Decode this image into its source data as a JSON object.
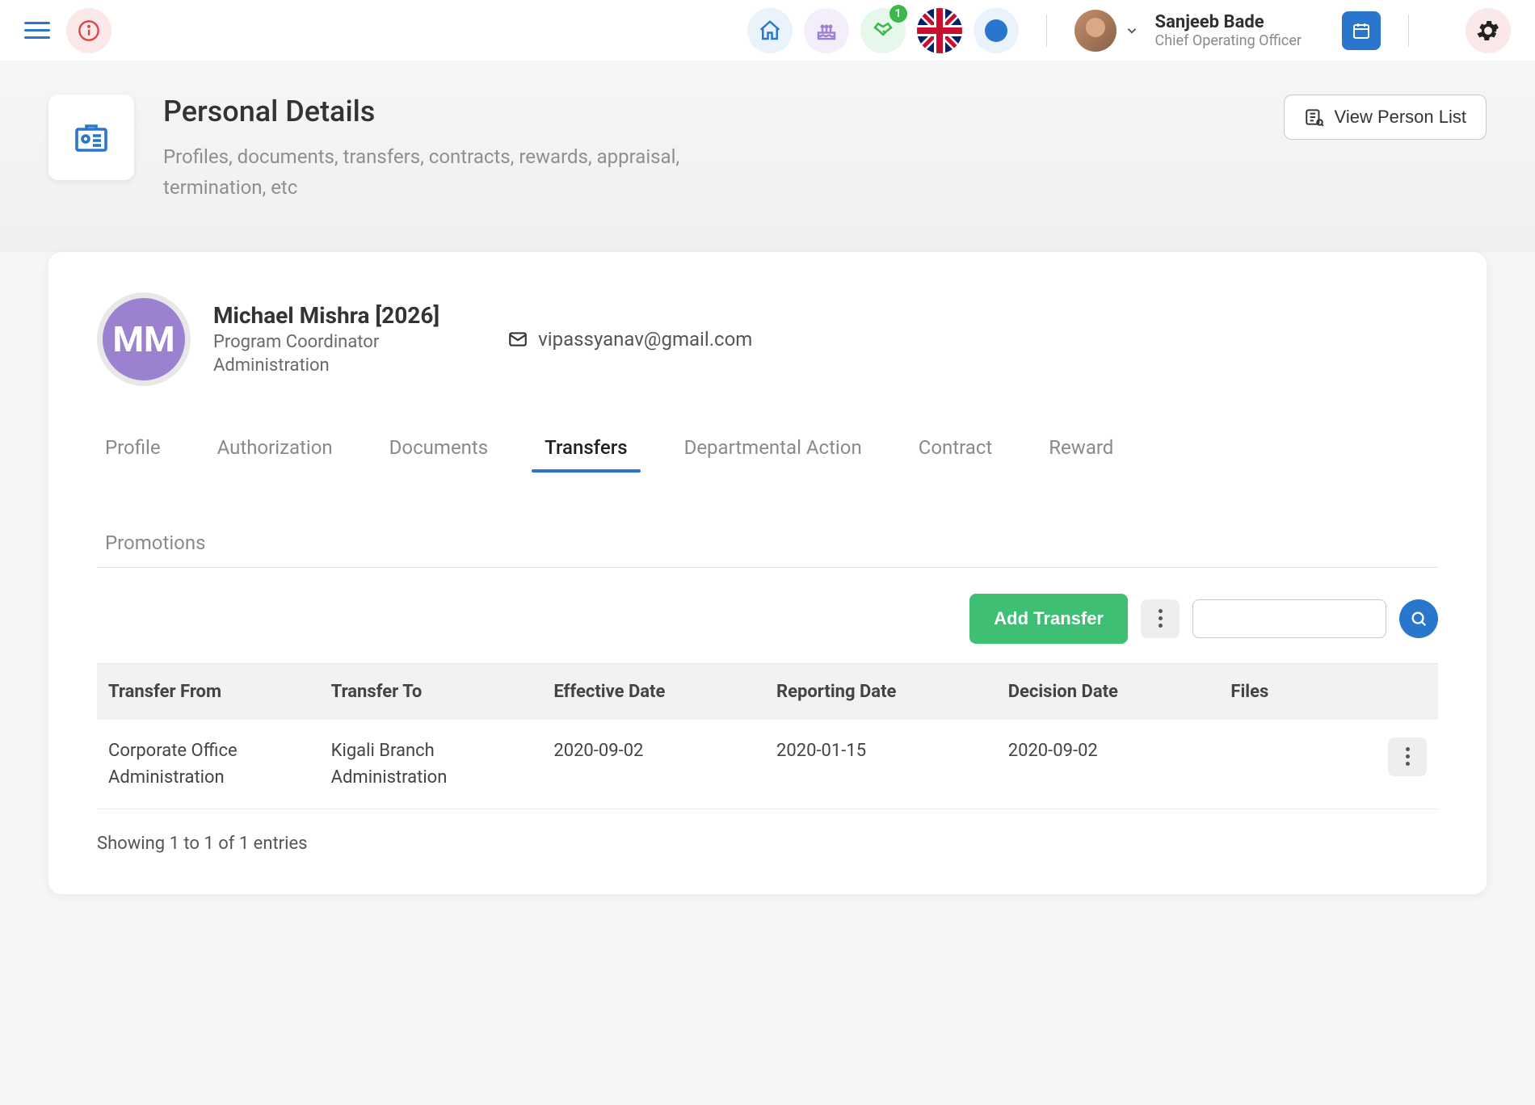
{
  "topbar": {
    "handshake_badge": "1",
    "user_name": "Sanjeeb Bade",
    "user_role": "Chief Operating Officer"
  },
  "header": {
    "title": "Personal Details",
    "subtitle": "Profiles, documents, transfers, contracts, rewards, appraisal, termination, etc",
    "view_list_label": "View Person List"
  },
  "person": {
    "initials": "MM",
    "name": "Michael Mishra [2026]",
    "role": "Program Coordinator",
    "department": "Administration",
    "email": "vipassyanav@gmail.com"
  },
  "tabs": {
    "profile": "Profile",
    "authorization": "Authorization",
    "documents": "Documents",
    "transfers": "Transfers",
    "departmental_action": "Departmental Action",
    "contract": "Contract",
    "reward": "Reward",
    "promotions": "Promotions"
  },
  "actions": {
    "add_transfer": "Add Transfer",
    "search_placeholder": ""
  },
  "table": {
    "headers": {
      "transfer_from": "Transfer From",
      "transfer_to": "Transfer To",
      "effective_date": "Effective Date",
      "reporting_date": "Reporting Date",
      "decision_date": "Decision Date",
      "files": "Files"
    },
    "rows": [
      {
        "transfer_from": "Corporate Office Administration",
        "transfer_to": "Kigali Branch Administration",
        "effective_date": "2020-09-02",
        "reporting_date": "2020-01-15",
        "decision_date": "2020-09-02",
        "files": ""
      }
    ]
  },
  "footer": {
    "entries_text": "Showing 1 to 1 of 1 entries"
  }
}
